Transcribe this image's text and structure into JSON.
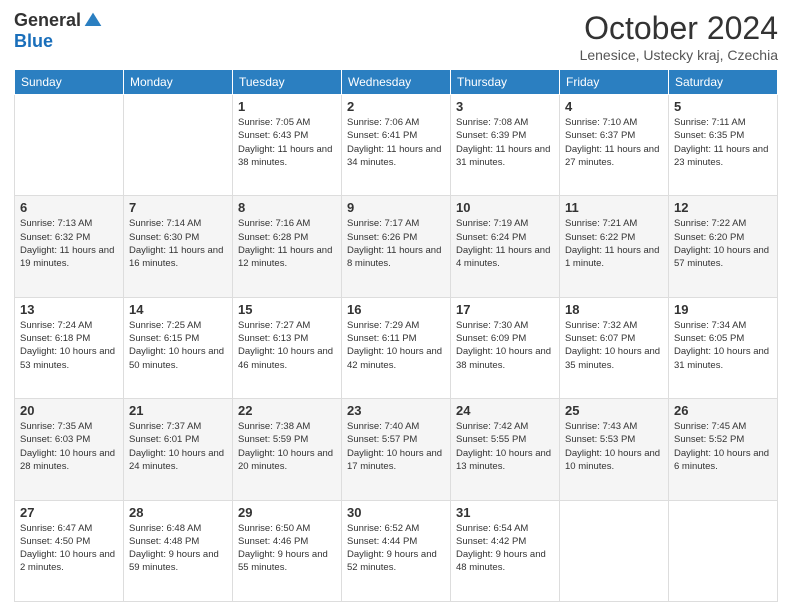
{
  "logo": {
    "general": "General",
    "blue": "Blue"
  },
  "header": {
    "month": "October 2024",
    "location": "Lenesice, Ustecky kraj, Czechia"
  },
  "weekdays": [
    "Sunday",
    "Monday",
    "Tuesday",
    "Wednesday",
    "Thursday",
    "Friday",
    "Saturday"
  ],
  "weeks": [
    [
      {
        "day": "",
        "sunrise": "",
        "sunset": "",
        "daylight": ""
      },
      {
        "day": "",
        "sunrise": "",
        "sunset": "",
        "daylight": ""
      },
      {
        "day": "1",
        "sunrise": "Sunrise: 7:05 AM",
        "sunset": "Sunset: 6:43 PM",
        "daylight": "Daylight: 11 hours and 38 minutes."
      },
      {
        "day": "2",
        "sunrise": "Sunrise: 7:06 AM",
        "sunset": "Sunset: 6:41 PM",
        "daylight": "Daylight: 11 hours and 34 minutes."
      },
      {
        "day": "3",
        "sunrise": "Sunrise: 7:08 AM",
        "sunset": "Sunset: 6:39 PM",
        "daylight": "Daylight: 11 hours and 31 minutes."
      },
      {
        "day": "4",
        "sunrise": "Sunrise: 7:10 AM",
        "sunset": "Sunset: 6:37 PM",
        "daylight": "Daylight: 11 hours and 27 minutes."
      },
      {
        "day": "5",
        "sunrise": "Sunrise: 7:11 AM",
        "sunset": "Sunset: 6:35 PM",
        "daylight": "Daylight: 11 hours and 23 minutes."
      }
    ],
    [
      {
        "day": "6",
        "sunrise": "Sunrise: 7:13 AM",
        "sunset": "Sunset: 6:32 PM",
        "daylight": "Daylight: 11 hours and 19 minutes."
      },
      {
        "day": "7",
        "sunrise": "Sunrise: 7:14 AM",
        "sunset": "Sunset: 6:30 PM",
        "daylight": "Daylight: 11 hours and 16 minutes."
      },
      {
        "day": "8",
        "sunrise": "Sunrise: 7:16 AM",
        "sunset": "Sunset: 6:28 PM",
        "daylight": "Daylight: 11 hours and 12 minutes."
      },
      {
        "day": "9",
        "sunrise": "Sunrise: 7:17 AM",
        "sunset": "Sunset: 6:26 PM",
        "daylight": "Daylight: 11 hours and 8 minutes."
      },
      {
        "day": "10",
        "sunrise": "Sunrise: 7:19 AM",
        "sunset": "Sunset: 6:24 PM",
        "daylight": "Daylight: 11 hours and 4 minutes."
      },
      {
        "day": "11",
        "sunrise": "Sunrise: 7:21 AM",
        "sunset": "Sunset: 6:22 PM",
        "daylight": "Daylight: 11 hours and 1 minute."
      },
      {
        "day": "12",
        "sunrise": "Sunrise: 7:22 AM",
        "sunset": "Sunset: 6:20 PM",
        "daylight": "Daylight: 10 hours and 57 minutes."
      }
    ],
    [
      {
        "day": "13",
        "sunrise": "Sunrise: 7:24 AM",
        "sunset": "Sunset: 6:18 PM",
        "daylight": "Daylight: 10 hours and 53 minutes."
      },
      {
        "day": "14",
        "sunrise": "Sunrise: 7:25 AM",
        "sunset": "Sunset: 6:15 PM",
        "daylight": "Daylight: 10 hours and 50 minutes."
      },
      {
        "day": "15",
        "sunrise": "Sunrise: 7:27 AM",
        "sunset": "Sunset: 6:13 PM",
        "daylight": "Daylight: 10 hours and 46 minutes."
      },
      {
        "day": "16",
        "sunrise": "Sunrise: 7:29 AM",
        "sunset": "Sunset: 6:11 PM",
        "daylight": "Daylight: 10 hours and 42 minutes."
      },
      {
        "day": "17",
        "sunrise": "Sunrise: 7:30 AM",
        "sunset": "Sunset: 6:09 PM",
        "daylight": "Daylight: 10 hours and 38 minutes."
      },
      {
        "day": "18",
        "sunrise": "Sunrise: 7:32 AM",
        "sunset": "Sunset: 6:07 PM",
        "daylight": "Daylight: 10 hours and 35 minutes."
      },
      {
        "day": "19",
        "sunrise": "Sunrise: 7:34 AM",
        "sunset": "Sunset: 6:05 PM",
        "daylight": "Daylight: 10 hours and 31 minutes."
      }
    ],
    [
      {
        "day": "20",
        "sunrise": "Sunrise: 7:35 AM",
        "sunset": "Sunset: 6:03 PM",
        "daylight": "Daylight: 10 hours and 28 minutes."
      },
      {
        "day": "21",
        "sunrise": "Sunrise: 7:37 AM",
        "sunset": "Sunset: 6:01 PM",
        "daylight": "Daylight: 10 hours and 24 minutes."
      },
      {
        "day": "22",
        "sunrise": "Sunrise: 7:38 AM",
        "sunset": "Sunset: 5:59 PM",
        "daylight": "Daylight: 10 hours and 20 minutes."
      },
      {
        "day": "23",
        "sunrise": "Sunrise: 7:40 AM",
        "sunset": "Sunset: 5:57 PM",
        "daylight": "Daylight: 10 hours and 17 minutes."
      },
      {
        "day": "24",
        "sunrise": "Sunrise: 7:42 AM",
        "sunset": "Sunset: 5:55 PM",
        "daylight": "Daylight: 10 hours and 13 minutes."
      },
      {
        "day": "25",
        "sunrise": "Sunrise: 7:43 AM",
        "sunset": "Sunset: 5:53 PM",
        "daylight": "Daylight: 10 hours and 10 minutes."
      },
      {
        "day": "26",
        "sunrise": "Sunrise: 7:45 AM",
        "sunset": "Sunset: 5:52 PM",
        "daylight": "Daylight: 10 hours and 6 minutes."
      }
    ],
    [
      {
        "day": "27",
        "sunrise": "Sunrise: 6:47 AM",
        "sunset": "Sunset: 4:50 PM",
        "daylight": "Daylight: 10 hours and 2 minutes."
      },
      {
        "day": "28",
        "sunrise": "Sunrise: 6:48 AM",
        "sunset": "Sunset: 4:48 PM",
        "daylight": "Daylight: 9 hours and 59 minutes."
      },
      {
        "day": "29",
        "sunrise": "Sunrise: 6:50 AM",
        "sunset": "Sunset: 4:46 PM",
        "daylight": "Daylight: 9 hours and 55 minutes."
      },
      {
        "day": "30",
        "sunrise": "Sunrise: 6:52 AM",
        "sunset": "Sunset: 4:44 PM",
        "daylight": "Daylight: 9 hours and 52 minutes."
      },
      {
        "day": "31",
        "sunrise": "Sunrise: 6:54 AM",
        "sunset": "Sunset: 4:42 PM",
        "daylight": "Daylight: 9 hours and 48 minutes."
      },
      {
        "day": "",
        "sunrise": "",
        "sunset": "",
        "daylight": ""
      },
      {
        "day": "",
        "sunrise": "",
        "sunset": "",
        "daylight": ""
      }
    ]
  ]
}
